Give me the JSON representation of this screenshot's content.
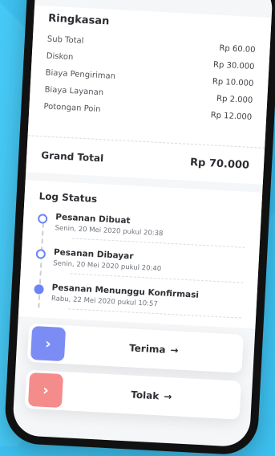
{
  "summary": {
    "title": "Ringkasan",
    "items": [
      {
        "label": "Sub Total",
        "value": "Rp 60.00"
      },
      {
        "label": "Diskon",
        "value": "Rp 30.000"
      },
      {
        "label": "Biaya Pengiriman",
        "value": "Rp 10.000"
      },
      {
        "label": "Biaya Layanan",
        "value": "Rp 2.000"
      },
      {
        "label": "Potongan Poin",
        "value": "Rp 12.000"
      }
    ],
    "grand_total_label": "Grand Total",
    "grand_total_value": "Rp 70.000"
  },
  "log": {
    "title": "Log Status",
    "steps": [
      {
        "title": "Pesanan Dibuat",
        "time": "Senin, 20 Mei 2020 pukul 20:38",
        "state": "done"
      },
      {
        "title": "Pesanan Dibayar",
        "time": "Senin, 20 Mei 2020 pukul 20:40",
        "state": "done"
      },
      {
        "title": "Pesanan Menunggu Konfirmasi",
        "time": "Rabu, 22 Mei 2020 pukul 10:57",
        "state": "current"
      }
    ]
  },
  "actions": {
    "accept": {
      "label": "Terima",
      "icon": "chevron-right-icon",
      "arrow": "→",
      "chevron": "›"
    },
    "reject": {
      "label": "Tolak",
      "icon": "chevron-right-icon",
      "arrow": "→",
      "chevron": "›"
    }
  },
  "colors": {
    "background": "#3dc1f0",
    "accept": "#7b8cf5",
    "reject": "#f48c8c",
    "timeline_accent": "#6b84f8"
  }
}
